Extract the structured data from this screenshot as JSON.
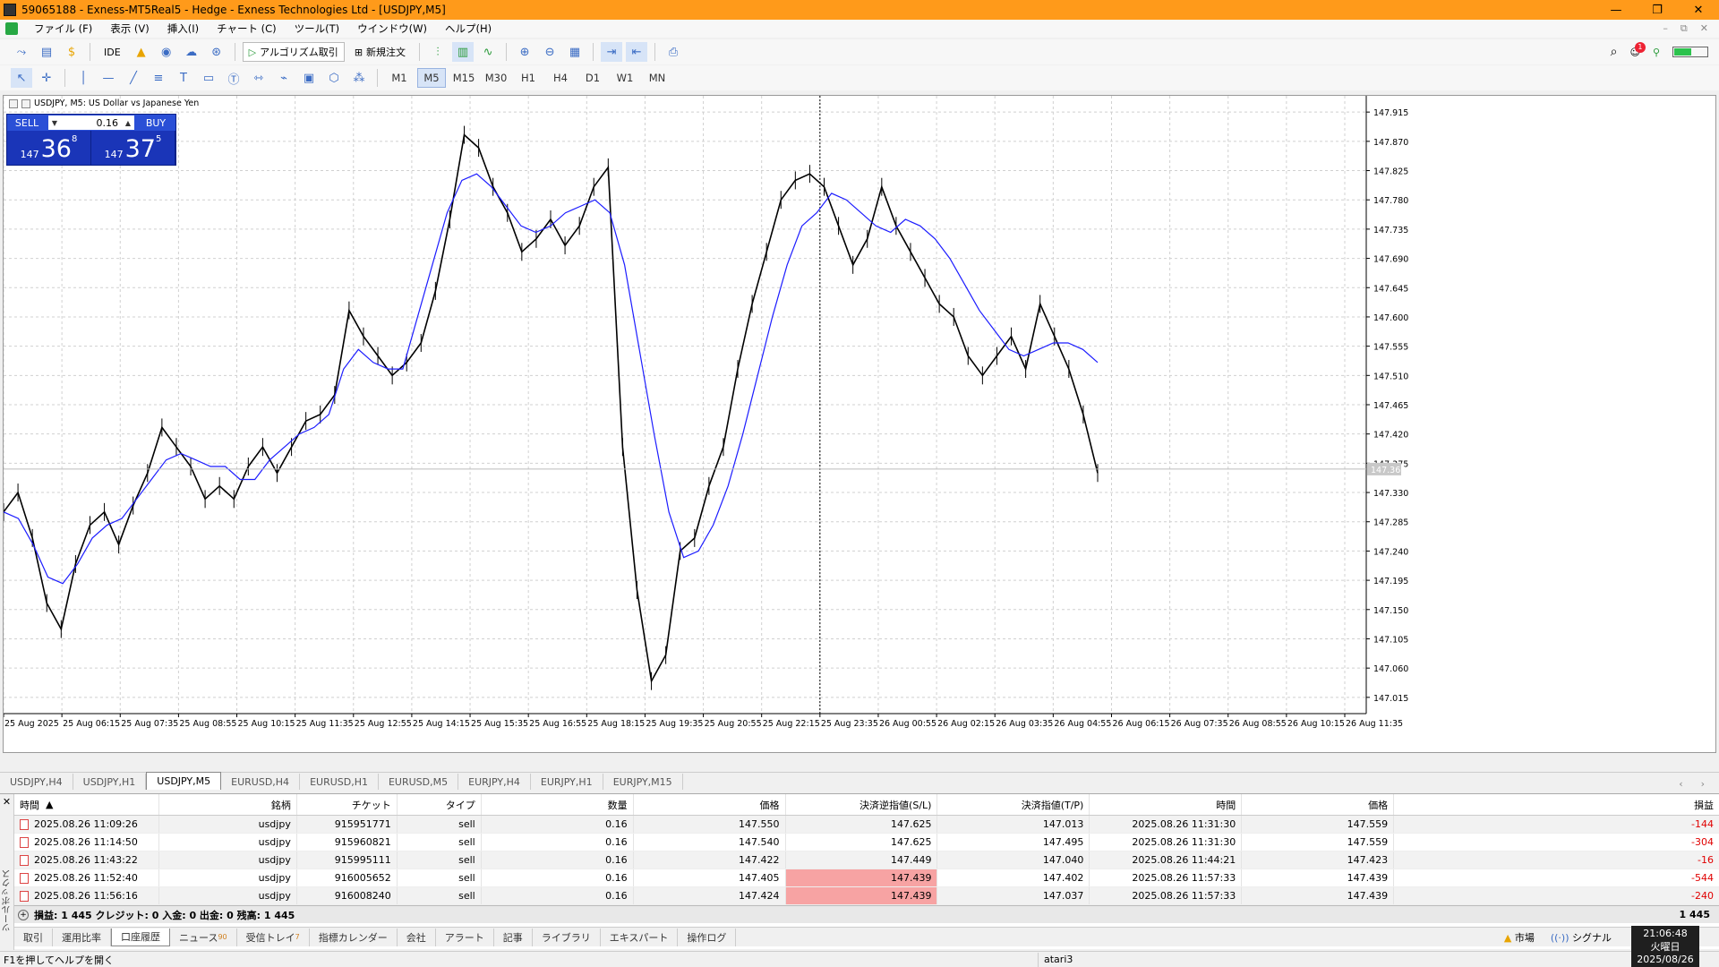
{
  "window": {
    "title": "59065188 - Exness-MT5Real5 - Hedge - Exness Technologies Ltd - [USDJPY,M5]"
  },
  "menu": [
    "ファイル (F)",
    "表示 (V)",
    "挿入(I)",
    "チャート (C)",
    "ツール(T)",
    "ウインドウ(W)",
    "ヘルプ(H)"
  ],
  "toolbar": {
    "ide": "IDE",
    "algo": "アルゴリズム取引",
    "new_order": "新規注文",
    "notification_count": "1",
    "battery_level": 0.5
  },
  "timeframes": [
    "M1",
    "M5",
    "M15",
    "M30",
    "H1",
    "H4",
    "D1",
    "W1",
    "MN"
  ],
  "active_timeframe": "M5",
  "chart": {
    "symbol_label": "USDJPY, M5:  US Dollar vs Japanese Yen",
    "current_price_label": "147.366",
    "price_axis": [
      "147.915",
      "147.870",
      "147.825",
      "147.780",
      "147.735",
      "147.690",
      "147.645",
      "147.600",
      "147.555",
      "147.510",
      "147.465",
      "147.420",
      "147.375",
      "147.330",
      "147.285",
      "147.240",
      "147.195",
      "147.150",
      "147.105",
      "147.060",
      "147.015"
    ],
    "time_axis": [
      "25 Aug 2025",
      "25 Aug 06:15",
      "25 Aug 07:35",
      "25 Aug 08:55",
      "25 Aug 10:15",
      "25 Aug 11:35",
      "25 Aug 12:55",
      "25 Aug 14:15",
      "25 Aug 15:35",
      "25 Aug 16:55",
      "25 Aug 18:15",
      "25 Aug 19:35",
      "25 Aug 20:55",
      "25 Aug 22:15",
      "25 Aug 23:35",
      "26 Aug 00:55",
      "26 Aug 02:15",
      "26 Aug 03:35",
      "26 Aug 04:55",
      "26 Aug 06:15",
      "26 Aug 07:35",
      "26 Aug 08:55",
      "26 Aug 10:15",
      "26 Aug 11:35"
    ],
    "colors": {
      "candles": "#000000",
      "ma": "#1c1cff",
      "grid": "#d0d0d0"
    }
  },
  "chart_data": {
    "type": "line",
    "ylim": [
      146.99,
      147.94
    ],
    "series": [
      {
        "values": [
          147.3,
          147.33,
          147.26,
          147.16,
          147.12,
          147.22,
          147.28,
          147.3,
          147.25,
          147.31,
          147.36,
          147.43,
          147.4,
          147.37,
          147.32,
          147.34,
          147.32,
          147.37,
          147.4,
          147.36,
          147.4,
          147.44,
          147.45,
          147.48,
          147.61,
          147.57,
          147.54,
          147.51,
          147.53,
          147.56,
          147.64,
          147.75,
          147.88,
          147.86,
          147.8,
          147.76,
          147.7,
          147.72,
          147.75,
          147.71,
          147.74,
          147.8,
          147.83,
          147.4,
          147.18,
          147.04,
          147.08,
          147.24,
          147.26,
          147.34,
          147.4,
          147.52,
          147.62,
          147.7,
          147.78,
          147.81,
          147.82,
          147.8,
          147.74,
          147.68,
          147.72,
          147.8,
          147.74,
          147.7,
          147.66,
          147.62,
          147.6,
          147.54,
          147.51,
          147.54,
          147.57,
          147.52,
          147.62,
          147.57,
          147.52,
          147.45,
          147.36
        ]
      },
      {
        "values": [
          147.3,
          147.29,
          147.25,
          147.2,
          147.19,
          147.22,
          147.26,
          147.28,
          147.29,
          147.32,
          147.35,
          147.38,
          147.39,
          147.38,
          147.37,
          147.37,
          147.35,
          147.35,
          147.38,
          147.4,
          147.42,
          147.43,
          147.45,
          147.52,
          147.55,
          147.53,
          147.52,
          147.52,
          147.6,
          147.68,
          147.76,
          147.81,
          147.82,
          147.8,
          147.77,
          147.74,
          147.73,
          147.74,
          147.76,
          147.77,
          147.78,
          147.76,
          147.68,
          147.55,
          147.42,
          147.3,
          147.23,
          147.24,
          147.28,
          147.34,
          147.42,
          147.51,
          147.6,
          147.68,
          147.74,
          147.76,
          147.79,
          147.78,
          147.76,
          147.74,
          147.73,
          147.75,
          147.74,
          147.72,
          147.69,
          147.65,
          147.61,
          147.58,
          147.55,
          147.54,
          147.55,
          147.56,
          147.56,
          147.55,
          147.53
        ]
      }
    ]
  },
  "trade_panel": {
    "sell": "SELL",
    "buy": "BUY",
    "lot": "0.16",
    "sell_prefix": "147",
    "sell_big": "36",
    "sell_sup": "8",
    "buy_prefix": "147",
    "buy_big": "37",
    "buy_sup": "5"
  },
  "chart_tabs": [
    "USDJPY,H4",
    "USDJPY,H1",
    "USDJPY,M5",
    "EURUSD,H4",
    "EURUSD,H1",
    "EURUSD,M5",
    "EURJPY,H4",
    "EURJPY,H1",
    "EURJPY,M15"
  ],
  "history": {
    "headers": [
      "時間",
      "銘柄",
      "チケット",
      "タイプ",
      "数量",
      "価格",
      "決済逆指値(S/L)",
      "決済指値(T/P)",
      "時間",
      "価格",
      "損益"
    ],
    "rows": [
      {
        "time": "2025.08.26 11:09:26",
        "symbol": "usdjpy",
        "ticket": "915951771",
        "type": "sell",
        "volume": "0.16",
        "price": "147.550",
        "sl": "147.625",
        "tp": "147.013",
        "close_time": "2025.08.26 11:31:30",
        "close_price": "147.559",
        "profit": "-144",
        "sl_hit": false
      },
      {
        "time": "2025.08.26 11:14:50",
        "symbol": "usdjpy",
        "ticket": "915960821",
        "type": "sell",
        "volume": "0.16",
        "price": "147.540",
        "sl": "147.625",
        "tp": "147.495",
        "close_time": "2025.08.26 11:31:30",
        "close_price": "147.559",
        "profit": "-304",
        "sl_hit": false
      },
      {
        "time": "2025.08.26 11:43:22",
        "symbol": "usdjpy",
        "ticket": "915995111",
        "type": "sell",
        "volume": "0.16",
        "price": "147.422",
        "sl": "147.449",
        "tp": "147.040",
        "close_time": "2025.08.26 11:44:21",
        "close_price": "147.423",
        "profit": "-16",
        "sl_hit": false
      },
      {
        "time": "2025.08.26 11:52:40",
        "symbol": "usdjpy",
        "ticket": "916005652",
        "type": "sell",
        "volume": "0.16",
        "price": "147.405",
        "sl": "147.439",
        "tp": "147.402",
        "close_time": "2025.08.26 11:57:33",
        "close_price": "147.439",
        "profit": "-544",
        "sl_hit": true
      },
      {
        "time": "2025.08.26 11:56:16",
        "symbol": "usdjpy",
        "ticket": "916008240",
        "type": "sell",
        "volume": "0.16",
        "price": "147.424",
        "sl": "147.439",
        "tp": "147.037",
        "close_time": "2025.08.26 11:57:33",
        "close_price": "147.439",
        "profit": "-240",
        "sl_hit": true
      }
    ],
    "summary": "損益: 1 445  クレジット: 0  入金: 0  出金: 0  残高: 1 445",
    "summary_total": "1 445"
  },
  "toolbox_label": "ツールボックス",
  "bottom_tabs": [
    "取引",
    "運用比率",
    "口座履歴",
    "ニュース",
    "受信トレイ",
    "指標カレンダー",
    "会社",
    "アラート",
    "記事",
    "ライブラリ",
    "エキスパート",
    "操作ログ"
  ],
  "bottom_tab_badges": {
    "news": "90",
    "inbox": "7"
  },
  "bottom_right": {
    "market": "市場",
    "signal": "シグナル"
  },
  "clock": {
    "time": "21:06:48",
    "day": "火曜日",
    "date": "2025/08/26"
  },
  "status": {
    "help": "F1を押してヘルプを開く",
    "account": "atari3"
  }
}
